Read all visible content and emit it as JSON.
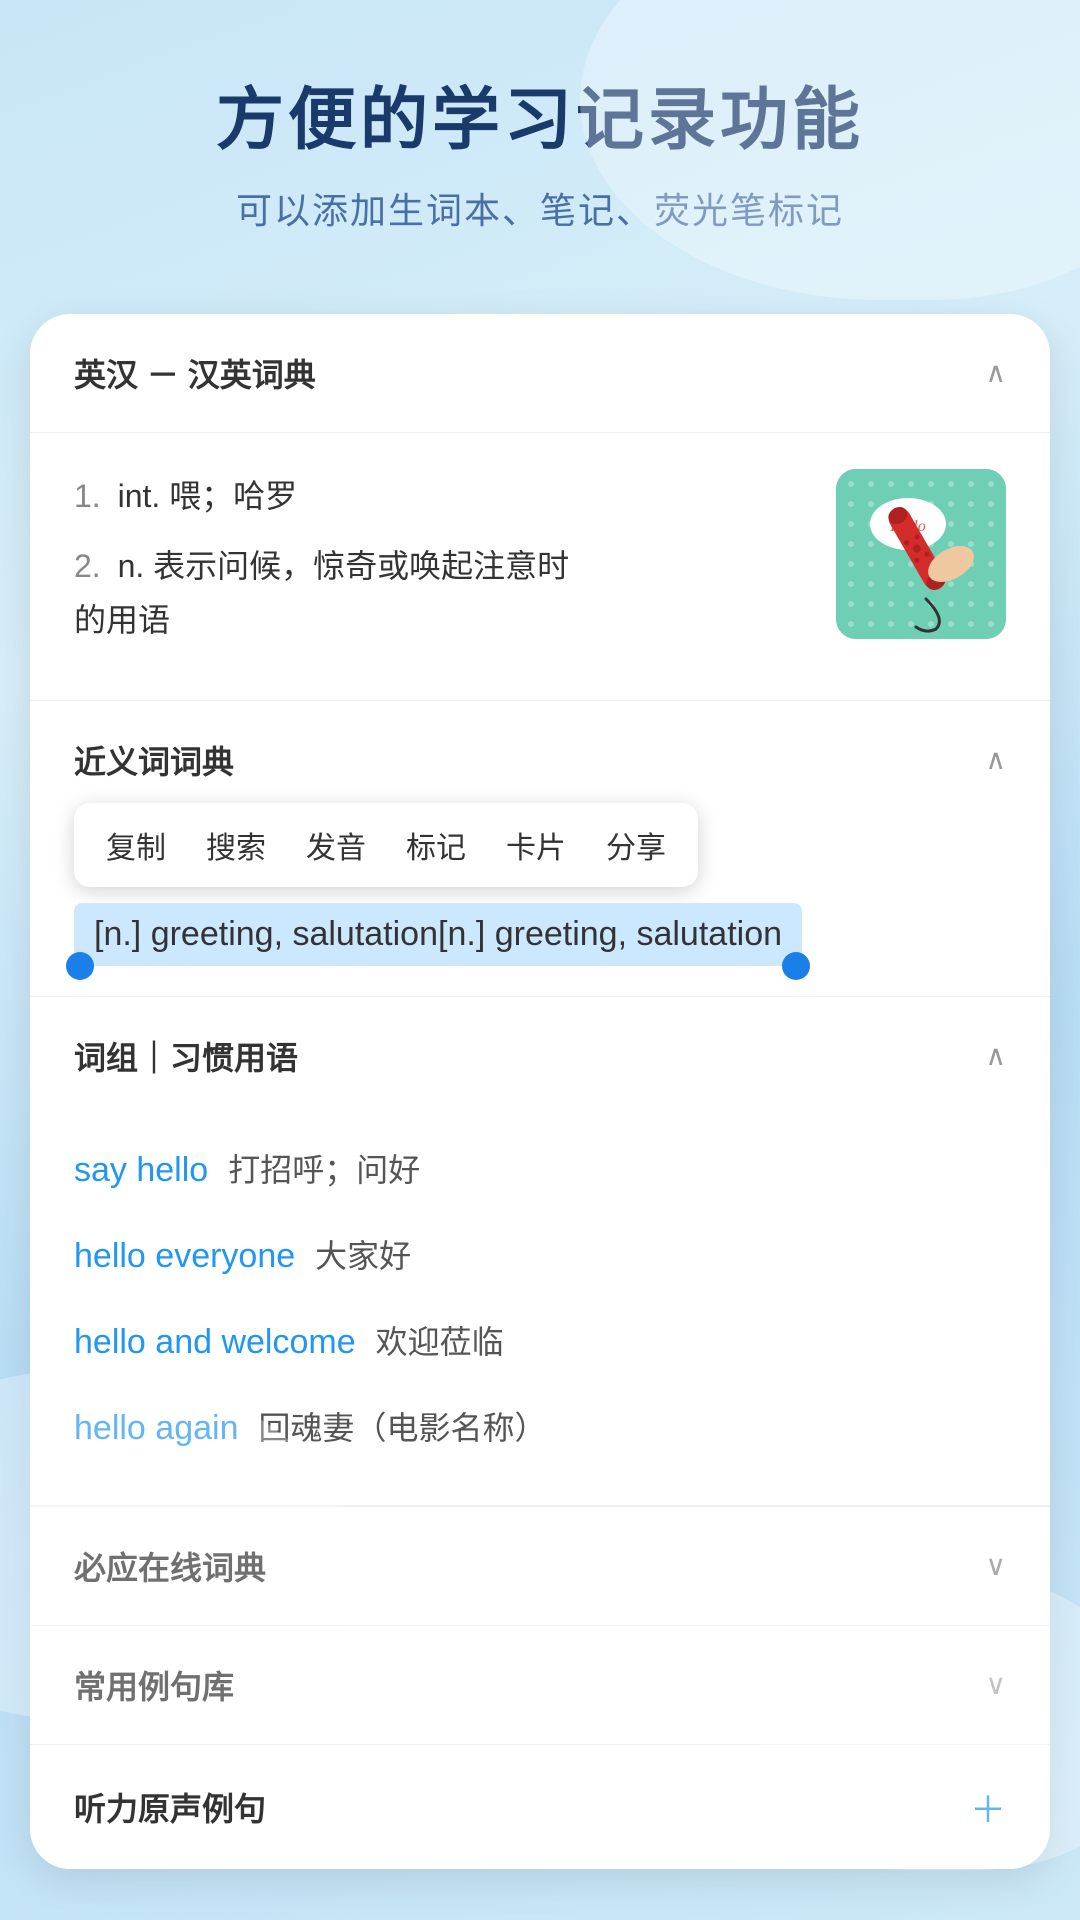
{
  "header": {
    "title": "方便的学习记录功能",
    "subtitle": "可以添加生词本、笔记、荧光笔标记"
  },
  "dict_section": {
    "title": "英汉 － 汉英词典",
    "definitions": [
      {
        "num": "1.",
        "pos": "int.",
        "meaning": "喂；哈罗"
      },
      {
        "num": "2.",
        "pos": "n.",
        "meaning": "表示问候，惊奇或唤起注意时的用语"
      }
    ]
  },
  "synonyms_section": {
    "title": "近义词词典",
    "context_menu": {
      "items": [
        "复制",
        "搜索",
        "发音",
        "标记",
        "卡片",
        "分享"
      ]
    },
    "selected_text": "[n.] greeting, salutation"
  },
  "phrases_section": {
    "title": "词组｜习惯用语",
    "items": [
      {
        "en": "say hello",
        "zh": "打招呼；问好"
      },
      {
        "en": "hello everyone",
        "zh": "大家好"
      },
      {
        "en": "hello and welcome",
        "zh": "欢迎莅临"
      },
      {
        "en": "hello again",
        "zh": "回魂妻（电影名称）"
      }
    ]
  },
  "collapsed_sections": [
    {
      "title": "必应在线词典",
      "icon": "chevron-down"
    },
    {
      "title": "常用例句库",
      "icon": "chevron-down"
    },
    {
      "title": "听力原声例句",
      "icon": "plus"
    }
  ]
}
